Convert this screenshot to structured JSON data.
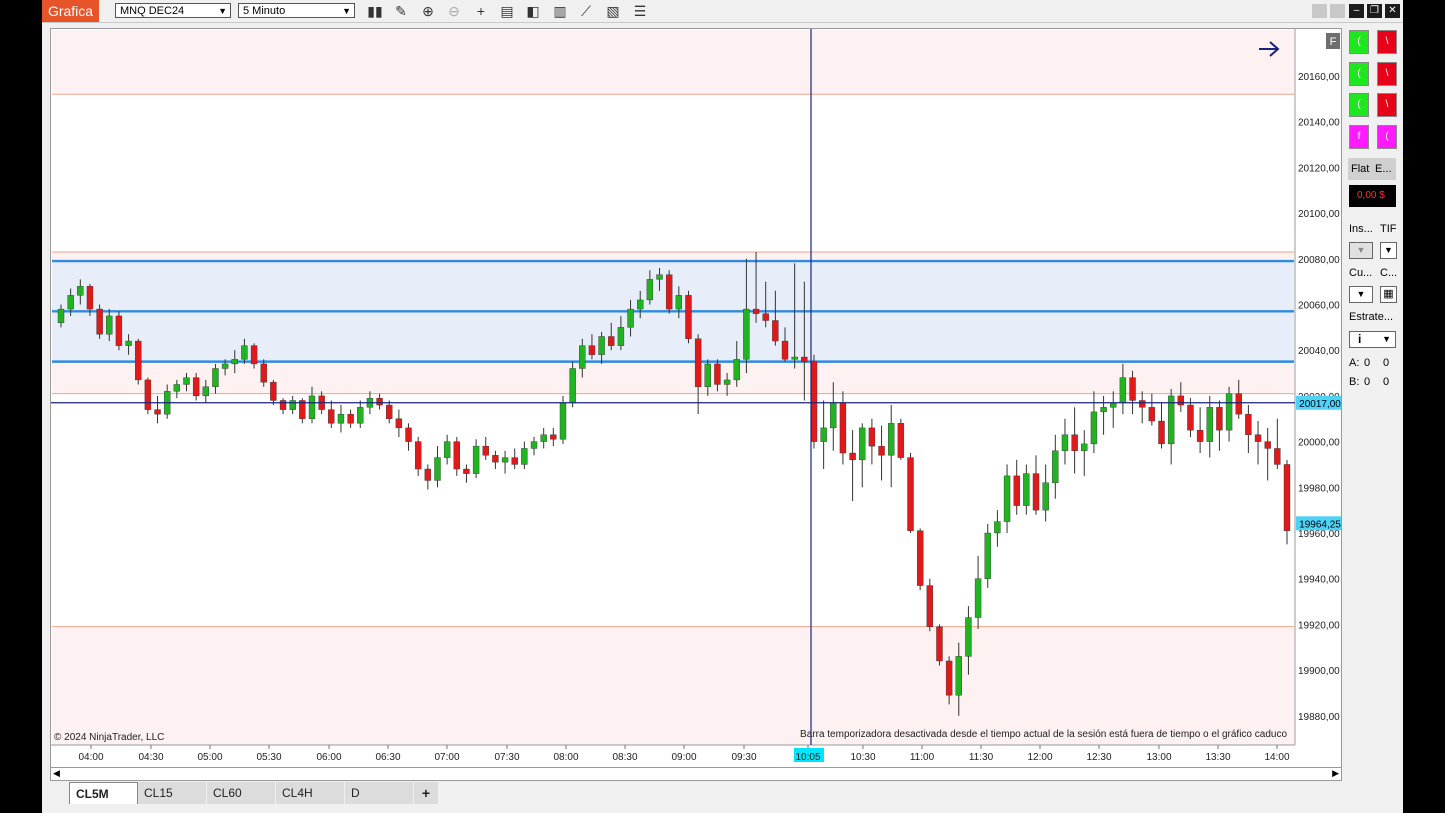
{
  "toolbar": {
    "app_title": "Grafica",
    "instrument": "MNQ DEC24",
    "interval": "5 Minuto"
  },
  "chart": {
    "copyright": "© 2024 NinjaTrader, LLC",
    "status_message": "Barra temporizadora desactivada desde el tiempo actual de la sesión está fuera de tiempo o el gráfico caduco",
    "price_ticks": [
      "20160,00",
      "20140,00",
      "20120,00",
      "20100,00",
      "20080,00",
      "20060,00",
      "20040,00",
      "20020,00",
      "20000,00",
      "19980,00",
      "19960,00",
      "19940,00",
      "19920,00",
      "19900,00",
      "19880,00"
    ],
    "time_ticks": [
      "04:00",
      "04:30",
      "05:00",
      "05:30",
      "06:00",
      "06:30",
      "07:00",
      "07:30",
      "08:00",
      "08:30",
      "09:00",
      "09:30",
      "10:05",
      "10:30",
      "11:00",
      "11:30",
      "12:00",
      "12:30",
      "13:00",
      "13:30",
      "14:00"
    ],
    "crosshair_time": "10:05",
    "crosshair_price": "20017,00",
    "last_price": "19964,25",
    "f_label": "F",
    "colors": {
      "up": "#22b322",
      "down": "#e01a1a",
      "level": "#2f8ae0",
      "zone": "#e8eef9",
      "pink_zone": "#fdf1f1",
      "crosshair": "#1a237e"
    }
  },
  "chart_data": {
    "type": "candlestick",
    "instrument": "MNQ DEC24",
    "interval": "5 Minuto",
    "y_range": [
      19870,
      20170
    ],
    "horizontal_levels": [
      20079,
      20057,
      20035,
      20017
    ],
    "candles_ohlc": [
      [
        20052,
        20060,
        20050,
        20058
      ],
      [
        20058,
        20067,
        20055,
        20064
      ],
      [
        20064,
        20071,
        20060,
        20068
      ],
      [
        20068,
        20069,
        20055,
        20058
      ],
      [
        20058,
        20060,
        20045,
        20047
      ],
      [
        20047,
        20058,
        20044,
        20055
      ],
      [
        20055,
        20057,
        20040,
        20042
      ],
      [
        20042,
        20047,
        20038,
        20044
      ],
      [
        20044,
        20045,
        20025,
        20027
      ],
      [
        20027,
        20028,
        20012,
        20014
      ],
      [
        20014,
        20020,
        20008,
        20012
      ],
      [
        20012,
        20025,
        20010,
        20022
      ],
      [
        20022,
        20027,
        20019,
        20025
      ],
      [
        20025,
        20030,
        20022,
        20028
      ],
      [
        20028,
        20030,
        20018,
        20020
      ],
      [
        20020,
        20027,
        20017,
        20024
      ],
      [
        20024,
        20034,
        20021,
        20032
      ],
      [
        20032,
        20036,
        20029,
        20034
      ],
      [
        20034,
        20040,
        20030,
        20036
      ],
      [
        20036,
        20045,
        20034,
        20042
      ],
      [
        20042,
        20043,
        20032,
        20034
      ],
      [
        20034,
        20036,
        20024,
        20026
      ],
      [
        20026,
        20027,
        20016,
        20018
      ],
      [
        20018,
        20019,
        20012,
        20014
      ],
      [
        20014,
        20020,
        20012,
        20018
      ],
      [
        20018,
        20019,
        20008,
        20010
      ],
      [
        20010,
        20024,
        20008,
        20020
      ],
      [
        20020,
        20022,
        20012,
        20014
      ],
      [
        20014,
        20018,
        20006,
        20008
      ],
      [
        20008,
        20016,
        20004,
        20012
      ],
      [
        20012,
        20014,
        20006,
        20008
      ],
      [
        20008,
        20018,
        20006,
        20015
      ],
      [
        20015,
        20022,
        20012,
        20019
      ],
      [
        20019,
        20021,
        20014,
        20016
      ],
      [
        20016,
        20018,
        20008,
        20010
      ],
      [
        20010,
        20014,
        20002,
        20006
      ],
      [
        20006,
        20008,
        19996,
        20000
      ],
      [
        20000,
        20002,
        19985,
        19988
      ],
      [
        19988,
        19990,
        19979,
        19983
      ],
      [
        19983,
        19998,
        19980,
        19993
      ],
      [
        19993,
        20003,
        19990,
        20000
      ],
      [
        20000,
        20002,
        19985,
        19988
      ],
      [
        19988,
        19990,
        19982,
        19986
      ],
      [
        19986,
        20001,
        19984,
        19998
      ],
      [
        19998,
        20002,
        19992,
        19994
      ],
      [
        19994,
        19996,
        19988,
        19991
      ],
      [
        19991,
        19996,
        19986,
        19993
      ],
      [
        19993,
        19997,
        19988,
        19990
      ],
      [
        19990,
        20000,
        19988,
        19997
      ],
      [
        19997,
        20002,
        19994,
        20000
      ],
      [
        20000,
        20006,
        19997,
        20003
      ],
      [
        20003,
        20006,
        19998,
        20001
      ],
      [
        20001,
        20020,
        19999,
        20017
      ],
      [
        20017,
        20035,
        20015,
        20032
      ],
      [
        20032,
        20045,
        20028,
        20042
      ],
      [
        20042,
        20047,
        20036,
        20038
      ],
      [
        20038,
        20048,
        20034,
        20046
      ],
      [
        20046,
        20052,
        20040,
        20042
      ],
      [
        20042,
        20055,
        20040,
        20050
      ],
      [
        20050,
        20062,
        20046,
        20058
      ],
      [
        20058,
        20066,
        20054,
        20062
      ],
      [
        20062,
        20075,
        20060,
        20071
      ],
      [
        20071,
        20076,
        20066,
        20073
      ],
      [
        20073,
        20075,
        20056,
        20058
      ],
      [
        20058,
        20068,
        20054,
        20064
      ],
      [
        20064,
        20066,
        20043,
        20045
      ],
      [
        20045,
        20047,
        20012,
        20024
      ],
      [
        20024,
        20036,
        20020,
        20034
      ],
      [
        20034,
        20036,
        20022,
        20025
      ],
      [
        20025,
        20030,
        20020,
        20027
      ],
      [
        20027,
        20044,
        20024,
        20036
      ],
      [
        20036,
        20080,
        20030,
        20058
      ],
      [
        20058,
        20083,
        20052,
        20056
      ],
      [
        20056,
        20070,
        20050,
        20053
      ],
      [
        20053,
        20066,
        20042,
        20044
      ],
      [
        20044,
        20050,
        20035,
        20036
      ],
      [
        20036,
        20078,
        20032,
        20037
      ],
      [
        20037,
        20070,
        20018,
        20035
      ],
      [
        20035,
        20038,
        19997,
        20000
      ],
      [
        20000,
        20018,
        19988,
        20006
      ],
      [
        20006,
        20026,
        19996,
        20017
      ],
      [
        20017,
        20022,
        19990,
        19995
      ],
      [
        19995,
        20005,
        19974,
        19992
      ],
      [
        19992,
        20008,
        19980,
        20006
      ],
      [
        20006,
        20010,
        19990,
        19998
      ],
      [
        19998,
        20007,
        19983,
        19994
      ],
      [
        19994,
        20016,
        19980,
        20008
      ],
      [
        20008,
        20010,
        19992,
        19993
      ],
      [
        19993,
        19995,
        19960,
        19961
      ],
      [
        19961,
        19962,
        19935,
        19937
      ],
      [
        19937,
        19940,
        19917,
        19919
      ],
      [
        19919,
        19920,
        19902,
        19904
      ],
      [
        19904,
        19906,
        19885,
        19889
      ],
      [
        19889,
        19912,
        19880,
        19906
      ],
      [
        19906,
        19928,
        19898,
        19923
      ],
      [
        19923,
        19950,
        19918,
        19940
      ],
      [
        19940,
        19964,
        19936,
        19960
      ],
      [
        19960,
        19970,
        19954,
        19965
      ],
      [
        19965,
        19990,
        19960,
        19985
      ],
      [
        19985,
        19992,
        19968,
        19972
      ],
      [
        19972,
        19990,
        19968,
        19986
      ],
      [
        19986,
        19994,
        19968,
        19970
      ],
      [
        19970,
        19990,
        19965,
        19982
      ],
      [
        19982,
        20003,
        19975,
        19996
      ],
      [
        19996,
        20010,
        19990,
        20003
      ],
      [
        20003,
        20015,
        19986,
        19996
      ],
      [
        19996,
        20005,
        19985,
        19999
      ],
      [
        19999,
        20022,
        19995,
        20013
      ],
      [
        20013,
        20020,
        20003,
        20015
      ],
      [
        20015,
        20022,
        20006,
        20017
      ],
      [
        20017,
        20034,
        20012,
        20028
      ],
      [
        20028,
        20031,
        20012,
        20018
      ],
      [
        20018,
        20022,
        20008,
        20015
      ],
      [
        20015,
        20021,
        20007,
        20009
      ],
      [
        20009,
        20017,
        19997,
        19999
      ],
      [
        19999,
        20023,
        19990,
        20020
      ],
      [
        20020,
        20026,
        20013,
        20016
      ],
      [
        20016,
        20019,
        20002,
        20005
      ],
      [
        20005,
        20015,
        19995,
        20000
      ],
      [
        20000,
        20020,
        19993,
        20015
      ],
      [
        20015,
        20018,
        19996,
        20005
      ],
      [
        20005,
        20024,
        20000,
        20021
      ],
      [
        20021,
        20027,
        20010,
        20012
      ],
      [
        20012,
        20016,
        19995,
        20003
      ],
      [
        20003,
        20009,
        19990,
        20000
      ],
      [
        20000,
        20006,
        19983,
        19997
      ],
      [
        19997,
        20010,
        19988,
        19990
      ],
      [
        19990,
        19992,
        19955,
        19961
      ]
    ]
  },
  "order_panel": {
    "flat": "Flat",
    "e_label": "E...",
    "pnl": "0,00 $",
    "ins": "Ins...",
    "tif": "TIF",
    "cu": "Cu...",
    "c": "C...",
    "estrate": "Estrate...",
    "strategy_value": "i",
    "a_label": "A:",
    "a1": "0",
    "a2": "0",
    "b_label": "B:",
    "b1": "0",
    "b2": "0"
  },
  "tabs": [
    "CL5M",
    "CL15",
    "CL60",
    "CL4H",
    "D"
  ],
  "add_tab": "+"
}
